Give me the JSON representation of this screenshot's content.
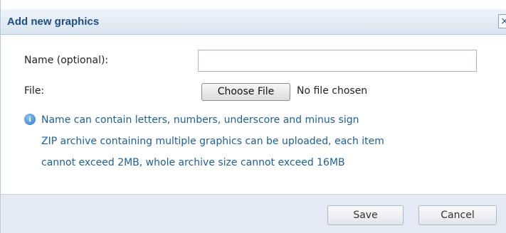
{
  "dialog": {
    "title": "Add new graphics",
    "close_label": "×"
  },
  "form": {
    "name_label": "Name (optional):",
    "name_value": "",
    "file_label": "File:",
    "choose_file_label": "Choose File",
    "no_file_text": "No file chosen"
  },
  "info": {
    "icon": "info-icon",
    "lines": [
      "Name can contain letters, numbers, underscore and minus sign",
      "ZIP archive containing multiple graphics can be uploaded, each item",
      "cannot exceed 2MB, whole archive size cannot exceed 16MB"
    ]
  },
  "footer": {
    "save_label": "Save",
    "cancel_label": "Cancel"
  },
  "colors": {
    "title": "#1d4f84",
    "info_text": "#1e5f97",
    "footer_bg": "#e4eaf3"
  }
}
